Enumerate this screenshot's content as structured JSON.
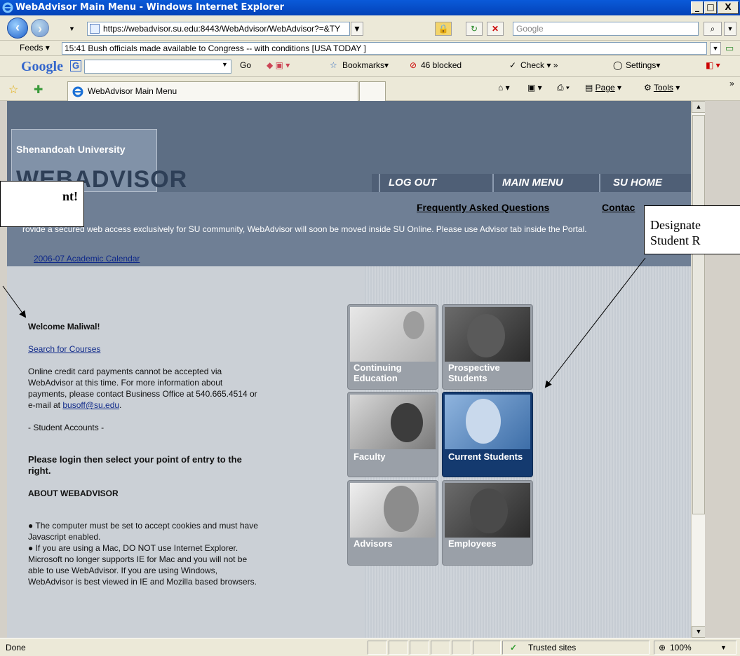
{
  "window": {
    "title": "WebAdvisor Main Menu - Windows Internet Explorer"
  },
  "address": {
    "url": "https://webadvisor.su.edu:8443/WebAdvisor/WebAdvisor?=&TY",
    "search_placeholder": "Google"
  },
  "feeds": {
    "label": "Feeds",
    "headline": "15:41  Bush officials made  available to Congress -- with conditions  [USA TODAY ]"
  },
  "google_toolbar": {
    "logo": "Google",
    "go": "Go",
    "bookmarks": "Bookmarks",
    "blocked": "46 blocked",
    "check": "Check",
    "settings": "Settings"
  },
  "tabs": {
    "active": "WebAdvisor Main Menu",
    "page": "Page",
    "tools": "Tools"
  },
  "banner": {
    "university": "Shenandoah University",
    "product": "WEBADVISOR",
    "nav": [
      "LOG OUT",
      "MAIN MENU",
      "SU HOME"
    ]
  },
  "info": {
    "faq": "Frequently Asked Questions",
    "contact": "Contac",
    "notice": "rovide a secured web access exclusively for SU community, WebAdvisor will soon be moved inside SU Online. Please use Advisor tab inside the Portal.",
    "calendar": "2006-07 Academic Calendar"
  },
  "left": {
    "welcome": "Welcome Maliwal!",
    "search_link": "Search for Courses",
    "payments_text": "Online credit card payments cannot be accepted via WebAdvisor at this time. For more information about payments, please contact Business Office at 540.665.4514 or e-mail at",
    "payments_email": "busoff@su.edu",
    "accounts": "- Student Accounts -",
    "login_prompt": "Please login then select your point of entry to the right.",
    "about_heading": "ABOUT WEBADVISOR",
    "bullet1": "●  The computer must be set to accept cookies and must have Javascript enabled.",
    "bullet2": "●  If you are using a Mac, DO NOT use Internet Explorer. Microsoft no longer supports IE for Mac and you will not be able to use WebAdvisor. If you are using Windows, WebAdvisor is best viewed in IE and Mozilla based browsers."
  },
  "tiles": [
    {
      "label": "Continuing Education"
    },
    {
      "label": "Prospective Students"
    },
    {
      "label": "Faculty"
    },
    {
      "label": "Current Students"
    },
    {
      "label": "Advisors"
    },
    {
      "label": "Employees"
    }
  ],
  "callouts": {
    "left": "nt!",
    "right_line1": "Designate",
    "right_line2": "Student R"
  },
  "status": {
    "left": "Done",
    "zone": "Trusted sites",
    "zoom": "100%"
  }
}
